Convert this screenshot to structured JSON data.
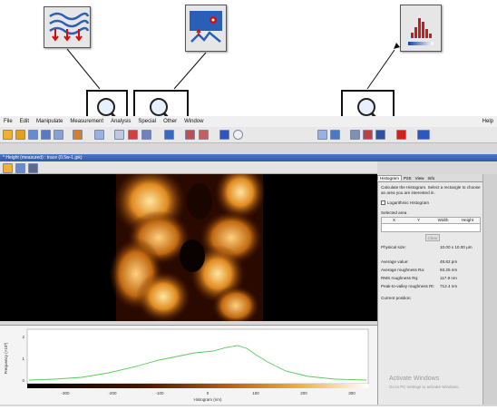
{
  "menu": [
    "File",
    "Edit",
    "Manipulate",
    "Measurement",
    "Analysis",
    "Special",
    "Other",
    "Window",
    "Help"
  ],
  "window_title": "* Height (measured) : trace (0.5w-1.jpk)",
  "right_panel": {
    "tabs": [
      "Histogram",
      "P2S",
      "View",
      "Info"
    ],
    "intro": "Calculate the Histogram. Select a rectangle to choose an area you are interested in.",
    "log_checkbox": "Logarithmic Histogram",
    "selected_area_label": "Selected area",
    "columns": [
      "X",
      "Y",
      "Width",
      "Height"
    ],
    "clear_button": "Clear",
    "physical_size_label": "Physical size:",
    "physical_size_value": "10.00 x 10.00 μm",
    "stats": [
      {
        "label": "Average value:",
        "value": "48.82 pm"
      },
      {
        "label": "Average roughness Ra:",
        "value": "93.25 nm"
      },
      {
        "label": "RMS roughness Rq:",
        "value": "117.9 nm"
      },
      {
        "label": "Peak-to-valley roughness Rt:",
        "value": "712.4 nm"
      }
    ],
    "current_position_label": "Current position:"
  },
  "graph": {
    "ylabel": "Frequency (×10³)",
    "xlabel": "Histogram (nm)",
    "x_ticks": [
      "-300",
      "-200",
      "-100",
      "0",
      "100",
      "200",
      "300"
    ],
    "y_ticks": [
      "0",
      "1",
      "2"
    ]
  },
  "watermark": [
    "Activate Windows",
    "Go to PC settings to activate Windows."
  ],
  "icons": [
    "line-correction-icon",
    "surface-leveling-icon",
    "histogram-icon",
    "magnifier-icon"
  ],
  "colors": {
    "accent": "#2d5aa8",
    "histogram_line": "#5ec85e"
  }
}
